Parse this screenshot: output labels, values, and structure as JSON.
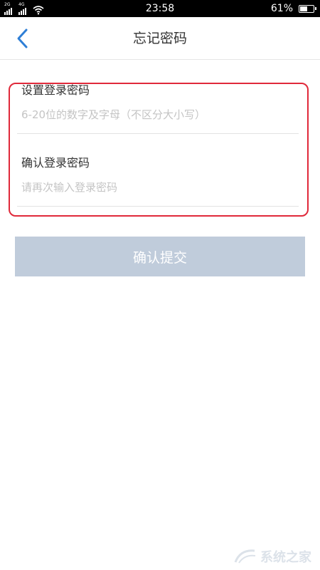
{
  "status_bar": {
    "sim1_tag": "2G",
    "sim2_tag": "4G",
    "time": "23:58",
    "battery_percent": "61%",
    "battery_level": 0.61
  },
  "header": {
    "title": "忘记密码"
  },
  "form": {
    "new_password": {
      "label": "设置登录密码",
      "placeholder": "6-20位的数字及字母（不区分大小写）"
    },
    "confirm_password": {
      "label": "确认登录密码",
      "placeholder": "请再次输入登录密码"
    },
    "highlight_color": "#e0293a"
  },
  "submit": {
    "label": "确认提交",
    "color": "#c0ccdb"
  },
  "watermark": {
    "text": "系统之家"
  }
}
